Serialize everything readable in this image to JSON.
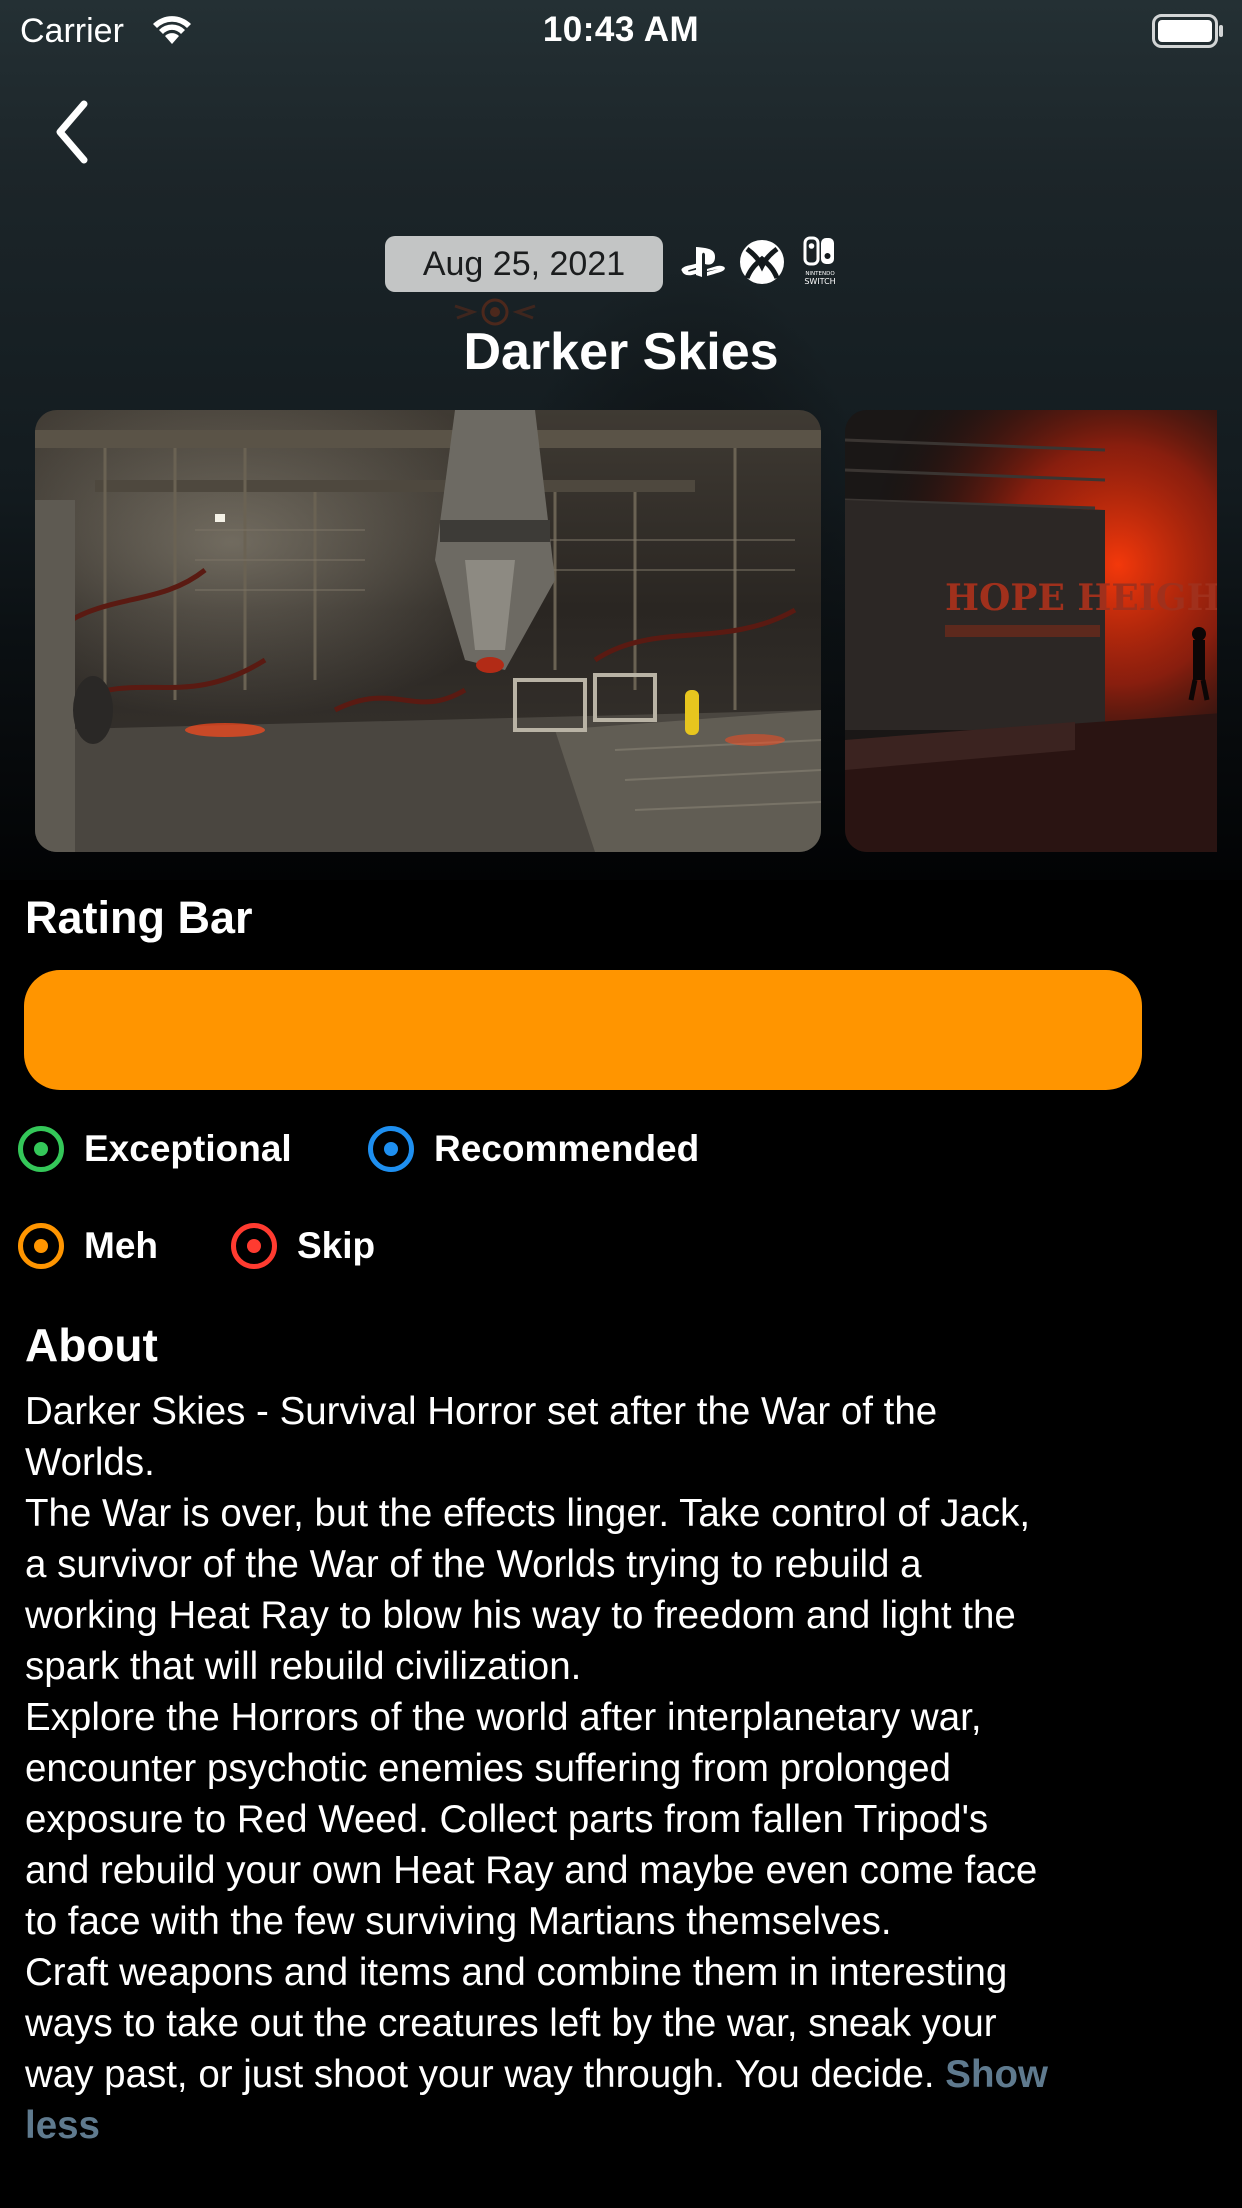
{
  "status_bar": {
    "carrier": "Carrier",
    "time": "10:43 AM"
  },
  "nav": {
    "back_icon": "chevron-left-icon"
  },
  "game": {
    "release_date": "Aug 25, 2021",
    "platform_icons": [
      "playstation-icon",
      "xbox-icon",
      "nintendo-switch-icon"
    ],
    "switch_logo_text": "SWITCH",
    "title": "Darker Skies"
  },
  "screenshots": {
    "items": [
      {
        "name": "screenshot-1",
        "sign_text": ""
      },
      {
        "name": "screenshot-2",
        "sign_text": "HOPE HEIGHTS"
      }
    ]
  },
  "rating": {
    "title": "Rating Bar",
    "bar_color": "#ff9500",
    "segments": [
      {
        "category": "Meh",
        "share": 1.0,
        "color": "#ff9500"
      }
    ],
    "legend": [
      {
        "label": "Exceptional",
        "color": "#34c759"
      },
      {
        "label": "Recommended",
        "color": "#1e8ff0"
      },
      {
        "label": "Meh",
        "color": "#ff9500"
      },
      {
        "label": "Skip",
        "color": "#ff3b30"
      }
    ]
  },
  "about": {
    "title": "About",
    "text": "Darker Skies - Survival Horror set after the War of the\nWorlds.\nThe War is over, but the effects linger. Take control of Jack,\na survivor of the War of the Worlds trying to rebuild a\nworking Heat Ray to blow his way to freedom and light the\nspark that will rebuild civilization.\nExplore the Horrors of the world after interplanetary war,\nencounter psychotic enemies suffering from prolonged\nexposure to Red Weed. Collect parts from fallen Tripod's\nand rebuild your own Heat Ray and maybe even come face\nto face with the few surviving Martians themselves.\nCraft weapons and items and combine them in interesting\nways to take out the creatures left by the war, sneak your\nway past, or just shoot your way through. You decide.",
    "toggle_label_1": "Show",
    "toggle_label_2": "less"
  }
}
